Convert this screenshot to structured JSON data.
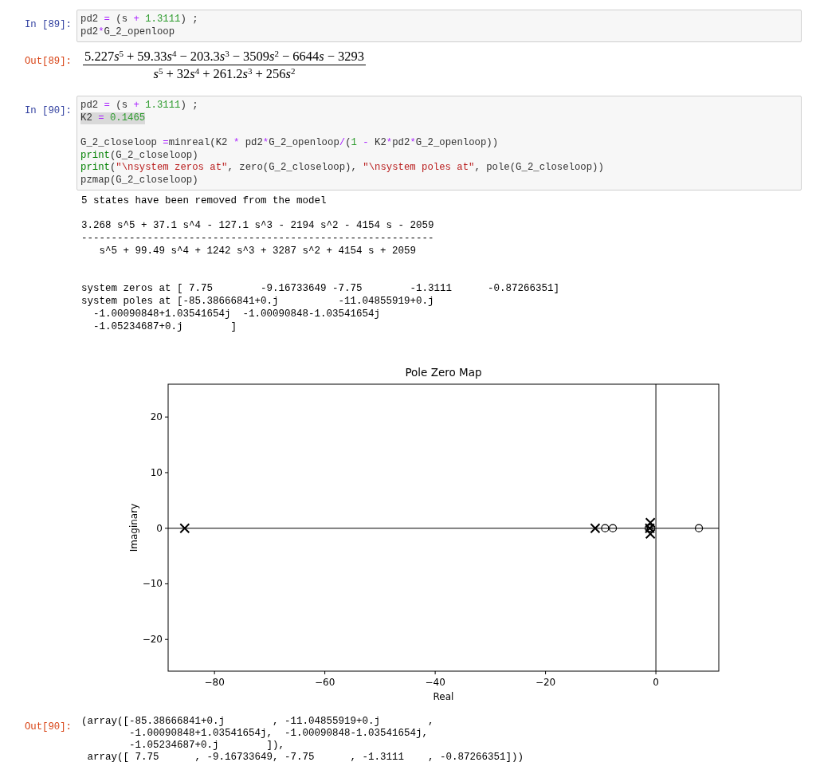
{
  "cells": [
    {
      "kind": "code",
      "prompt": "In [89]:",
      "lines": [
        {
          "kind": "code",
          "highlighted": false,
          "tokens": [
            {
              "kind": "plain",
              "text": "pd2 "
            },
            {
              "kind": "op",
              "text": "="
            },
            {
              "kind": "plain",
              "text": " (s "
            },
            {
              "kind": "op",
              "text": "+ "
            },
            {
              "kind": "num",
              "text": "1.3111"
            },
            {
              "kind": "plain",
              "text": ") ;"
            }
          ]
        },
        {
          "kind": "code",
          "highlighted": false,
          "tokens": [
            {
              "kind": "plain",
              "text": "pd2"
            },
            {
              "kind": "op",
              "text": "*"
            },
            {
              "kind": "plain",
              "text": "G_2_openloop"
            }
          ]
        }
      ]
    },
    {
      "kind": "math",
      "prompt": "Out[89]:",
      "numerator": [
        {
          "kind": "coef",
          "text": "5.227"
        },
        {
          "kind": "var",
          "text": "s"
        },
        {
          "kind": "sup",
          "text": "5"
        },
        {
          "kind": "op",
          "text": "+"
        },
        {
          "kind": "coef",
          "text": "59.33"
        },
        {
          "kind": "var",
          "text": "s"
        },
        {
          "kind": "sup",
          "text": "4"
        },
        {
          "kind": "op",
          "text": "−"
        },
        {
          "kind": "coef",
          "text": "203.3"
        },
        {
          "kind": "var",
          "text": "s"
        },
        {
          "kind": "sup",
          "text": "3"
        },
        {
          "kind": "op",
          "text": "−"
        },
        {
          "kind": "coef",
          "text": "3509"
        },
        {
          "kind": "var",
          "text": "s"
        },
        {
          "kind": "sup",
          "text": "2"
        },
        {
          "kind": "op",
          "text": "−"
        },
        {
          "kind": "coef",
          "text": "6644"
        },
        {
          "kind": "var",
          "text": "s"
        },
        {
          "kind": "op",
          "text": "−"
        },
        {
          "kind": "coef",
          "text": "3293"
        }
      ],
      "denominator": [
        {
          "kind": "var",
          "text": "s"
        },
        {
          "kind": "sup",
          "text": "5"
        },
        {
          "kind": "op",
          "text": "+"
        },
        {
          "kind": "coef",
          "text": "32"
        },
        {
          "kind": "var",
          "text": "s"
        },
        {
          "kind": "sup",
          "text": "4"
        },
        {
          "kind": "op",
          "text": "+"
        },
        {
          "kind": "coef",
          "text": "261.2"
        },
        {
          "kind": "var",
          "text": "s"
        },
        {
          "kind": "sup",
          "text": "3"
        },
        {
          "kind": "op",
          "text": "+"
        },
        {
          "kind": "coef",
          "text": "256"
        },
        {
          "kind": "var",
          "text": "s"
        },
        {
          "kind": "sup",
          "text": "2"
        }
      ]
    },
    {
      "kind": "code",
      "prompt": "In [90]:",
      "lines": [
        {
          "kind": "code",
          "highlighted": false,
          "tokens": [
            {
              "kind": "plain",
              "text": "pd2 "
            },
            {
              "kind": "op",
              "text": "="
            },
            {
              "kind": "plain",
              "text": " (s "
            },
            {
              "kind": "op",
              "text": "+ "
            },
            {
              "kind": "num",
              "text": "1.3111"
            },
            {
              "kind": "plain",
              "text": ") ;"
            }
          ]
        },
        {
          "kind": "code",
          "highlighted": true,
          "tokens": [
            {
              "kind": "plain",
              "text": "K2 "
            },
            {
              "kind": "op",
              "text": "= "
            },
            {
              "kind": "num",
              "text": "0.1465"
            }
          ]
        },
        {
          "kind": "blank"
        },
        {
          "kind": "code",
          "highlighted": false,
          "tokens": [
            {
              "kind": "plain",
              "text": "G_2_closeloop "
            },
            {
              "kind": "op",
              "text": "="
            },
            {
              "kind": "plain",
              "text": "minreal(K2 "
            },
            {
              "kind": "op",
              "text": "*"
            },
            {
              "kind": "plain",
              "text": " pd2"
            },
            {
              "kind": "op",
              "text": "*"
            },
            {
              "kind": "plain",
              "text": "G_2_openloop"
            },
            {
              "kind": "op",
              "text": "/"
            },
            {
              "kind": "plain",
              "text": "("
            },
            {
              "kind": "num",
              "text": "1"
            },
            {
              "kind": "op",
              "text": " -"
            },
            {
              "kind": "plain",
              "text": " K2"
            },
            {
              "kind": "op",
              "text": "*"
            },
            {
              "kind": "plain",
              "text": "pd2"
            },
            {
              "kind": "op",
              "text": "*"
            },
            {
              "kind": "plain",
              "text": "G_2_openloop))"
            }
          ]
        },
        {
          "kind": "code",
          "highlighted": false,
          "tokens": [
            {
              "kind": "builtin",
              "text": "print"
            },
            {
              "kind": "plain",
              "text": "(G_2_closeloop)"
            }
          ]
        },
        {
          "kind": "code",
          "highlighted": false,
          "tokens": [
            {
              "kind": "builtin",
              "text": "print"
            },
            {
              "kind": "plain",
              "text": "("
            },
            {
              "kind": "str",
              "text": "\"\\nsystem zeros at\""
            },
            {
              "kind": "plain",
              "text": ", zero(G_2_closeloop), "
            },
            {
              "kind": "str",
              "text": "\"\\nsystem poles at\""
            },
            {
              "kind": "plain",
              "text": ", pole(G_2_closeloop))"
            }
          ]
        },
        {
          "kind": "code",
          "highlighted": false,
          "tokens": [
            {
              "kind": "plain",
              "text": "pzmap(G_2_closeloop)"
            }
          ]
        }
      ]
    },
    {
      "kind": "stdout",
      "blocks": [
        [
          "5 states have been removed from the model"
        ],
        [
          "3.268 s^5 + 37.1 s^4 - 127.1 s^3 - 2194 s^2 - 4154 s - 2059",
          "-----------------------------------------------------------",
          "   s^5 + 99.49 s^4 + 1242 s^3 + 3287 s^2 + 4154 s + 2059"
        ],
        [
          "system zeros at [ 7.75        -9.16733649 -7.75        -1.3111      -0.87266351]",
          "system poles at [-85.38666841+0.j          -11.04855919+0.j",
          "  -1.00090848+1.03541654j  -1.00090848-1.03541654j",
          "  -1.05234687+0.j        ]"
        ]
      ]
    },
    {
      "kind": "chart",
      "chart_data": {
        "type": "scatter",
        "title": "Pole Zero Map",
        "xlabel": "Real",
        "ylabel": "Imaginary",
        "xlim": [
          -88.4,
          11.4
        ],
        "ylim": [
          -25.7,
          25.9
        ],
        "xticks": [
          {
            "value": -80,
            "label": "−80"
          },
          {
            "value": -60,
            "label": "−60"
          },
          {
            "value": -40,
            "label": "−40"
          },
          {
            "value": -20,
            "label": "−20"
          },
          0
        ],
        "yticks": [
          {
            "value": -20,
            "label": "−20"
          },
          {
            "value": -10,
            "label": "−10"
          },
          0,
          10,
          20
        ],
        "series": [
          {
            "color": "#000000",
            "x": [
              -85.4,
              -11.0,
              -1.0,
              -1.0,
              -1.1
            ],
            "values": [
              0,
              0,
              1.0,
              -1.0,
              0
            ]
          },
          {
            "color": "#000000",
            "x": [
              7.8,
              -9.2,
              -7.8,
              -1.3,
              -0.9
            ],
            "values": [
              0,
              0,
              0,
              0,
              0
            ]
          }
        ]
      }
    },
    {
      "kind": "result",
      "prompt": "Out[90]:",
      "lines": [
        "(array([-85.38666841+0.j        , -11.04855919+0.j        ,",
        "        -1.00090848+1.03541654j,  -1.00090848-1.03541654j,",
        "        -1.05234687+0.j        ]),",
        " array([ 7.75      , -9.16733649, -7.75      , -1.3111    , -0.87266351]))"
      ]
    }
  ]
}
